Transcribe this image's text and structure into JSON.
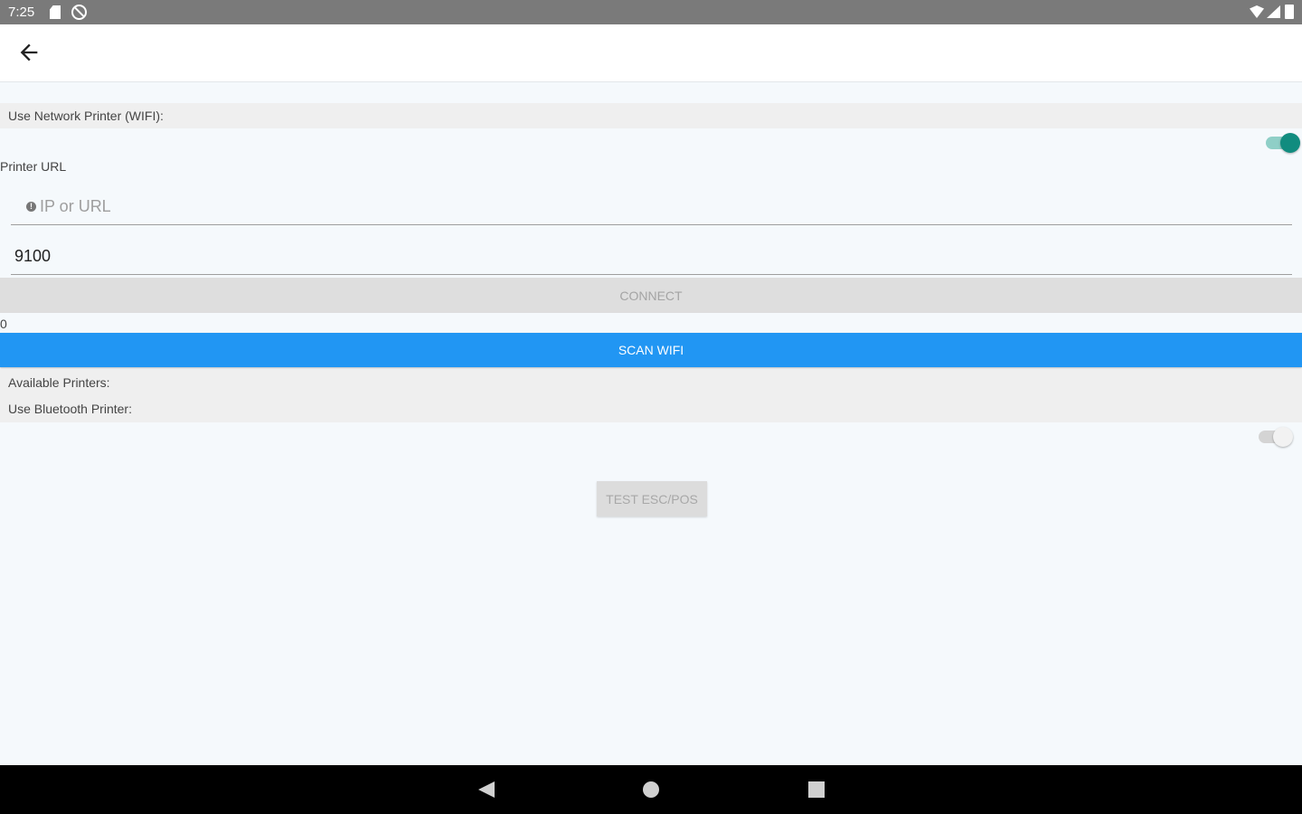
{
  "status_bar": {
    "time": "7:25",
    "icons": [
      "sd-card-icon",
      "blocked-icon",
      "wifi-icon",
      "signal-icon",
      "battery-icon"
    ]
  },
  "app_bar": {
    "back_icon": "arrow-left-icon"
  },
  "network": {
    "section_label": "Use Network Printer (WIFI):",
    "toggle_on": true,
    "printer_url_label": "Printer URL",
    "url_placeholder": "IP or URL",
    "url_value": "",
    "port_value": "9100",
    "connect_label": "CONNECT",
    "status_text": "0",
    "scan_label": "SCAN WIFI",
    "available_label": "Available Printers:"
  },
  "bluetooth": {
    "section_label": "Use Bluetooth Printer:",
    "toggle_on": false
  },
  "test_button_label": "TEST ESC/POS",
  "colors": {
    "accent": "#2196f3",
    "toggle_on": "#118c7f",
    "background": "#f5f9fc"
  }
}
